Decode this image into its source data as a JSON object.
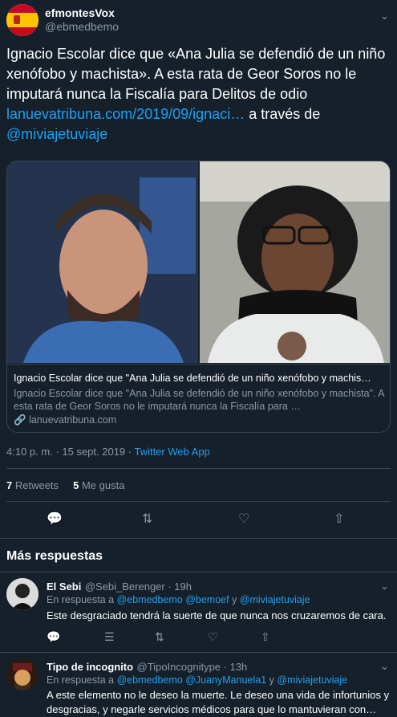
{
  "tweet": {
    "author_name": "efmontesVox",
    "author_handle": "@ebmedbemo",
    "text_main": "Ignacio Escolar dice que «Ana Julia se defendió de un niño xenófobo y machista». A esta rata de Geor Soros no le imputará nunca la Fiscalía para Delitos de odio",
    "link": "lanuevatribuna.com/2019/09/ignaci…",
    "via": " a través de ",
    "mention": "@miviajetuviaje",
    "card": {
      "title": "Ignacio Escolar dice que \"Ana Julia se defendió de un niño xenófobo y machis…",
      "description": "Ignacio Escolar dice que \"Ana Julia se defendió de un niño xenófobo y machista\". A esta rata de Geor Soros no le imputará nunca la Fiscalía para …",
      "domain": "lanuevatribuna.com"
    },
    "timestamp": "4:10 p. m. · 15 sept. 2019 · ",
    "source": "Twitter Web App",
    "retweets_count": "7",
    "retweets_label": " Retweets",
    "likes_count": "5",
    "likes_label": " Me gusta"
  },
  "icons": {
    "reply": "reply-icon",
    "retweet": "retweet-icon",
    "like": "like-icon",
    "share": "share-icon",
    "chevron": "chevron-down-icon"
  },
  "section_title": "Más respuestas",
  "replies": [
    {
      "name": "El Sebi",
      "handle": "@Sebi_Berenger · 19h",
      "reply_prefix": "En respuesta a ",
      "reply_to": "@ebmedbemo @bemoef",
      "reply_and": " y ",
      "reply_to2": "@miviajetuviaje",
      "text": "Este desgraciado tendrá la suerte de que nunca nos cruzaremos de cara."
    },
    {
      "name": "Tipo de incognito",
      "handle": "@TipoIncognitype · 13h",
      "reply_prefix": "En respuesta a ",
      "reply_to": "@ebmedbemo @JuanyManuela1",
      "reply_and": " y ",
      "reply_to2": "@miviajetuviaje",
      "text": "A este elemento no le deseo la muerte. Le deseo una vida de infortunios y desgracias, y negarle servicios médicos para que lo mantuvieran con…"
    }
  ],
  "colors": {
    "background": "#15202b",
    "accent": "#1da1f2",
    "muted": "#8899a6",
    "border": "#38444d"
  }
}
